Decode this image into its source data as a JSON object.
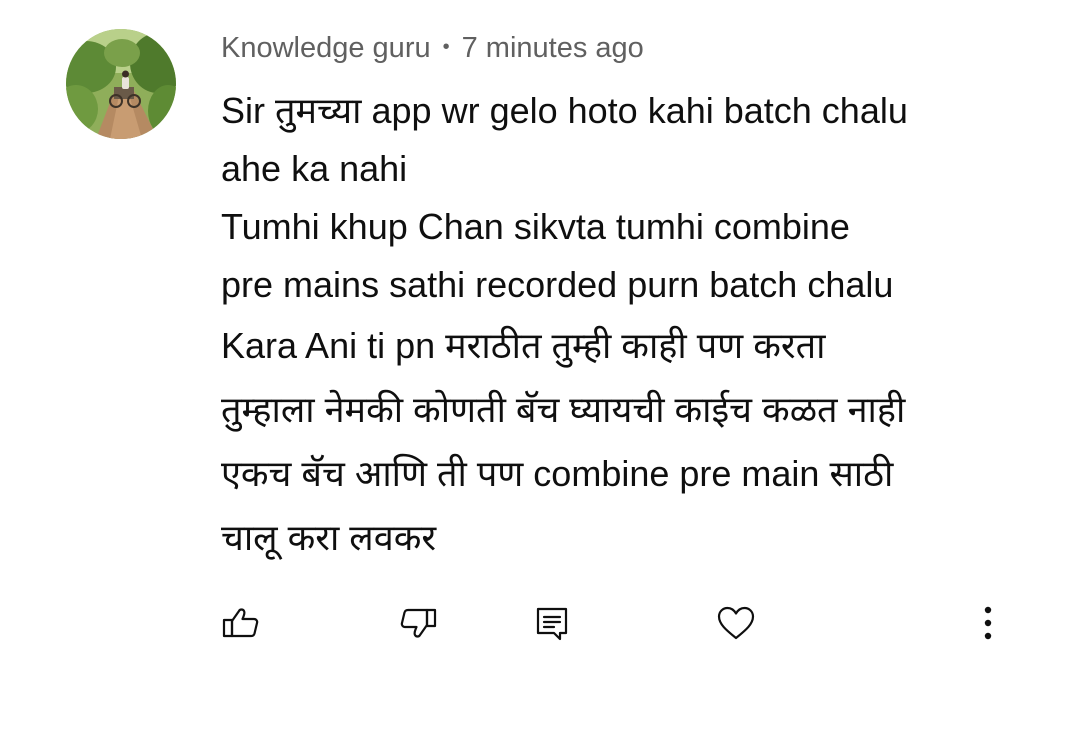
{
  "comment": {
    "author": "Knowledge guru",
    "separator": "•",
    "timestamp": "7 minutes ago",
    "lines": [
      "Sir तुमच्या app wr gelo hoto kahi batch chalu",
      "ahe ka nahi",
      "Tumhi khup Chan sikvta tumhi combine",
      "pre mains sathi recorded purn batch chalu",
      "Kara Ani ti pn मराठीत तुम्ही काही पण करता",
      "तुम्हाला नेमकी कोणती बॅच घ्यायची काईच कळत नाही",
      "एकच बॅच आणि ती पण combine pre main साठी",
      "चालू करा लवकर"
    ]
  },
  "actions": {
    "like_icon": "thumb-up-icon",
    "dislike_icon": "thumb-down-icon",
    "reply_icon": "reply-comment-icon",
    "heart_icon": "heart-icon",
    "more_icon": "more-vertical-icon"
  },
  "colors": {
    "text_primary": "#0f0f0f",
    "text_secondary": "#606060",
    "background": "#ffffff"
  }
}
